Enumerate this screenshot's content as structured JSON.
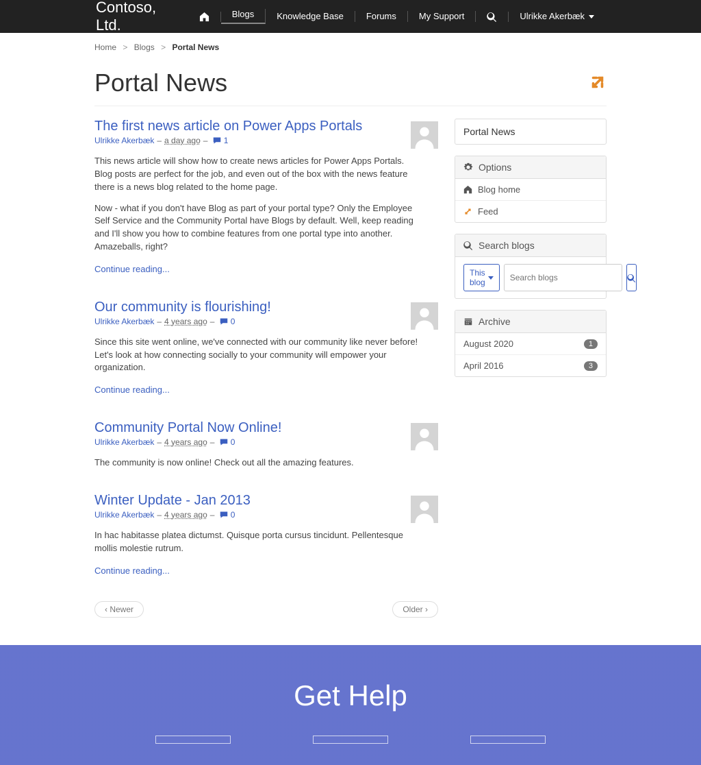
{
  "brand": "Contoso, Ltd.",
  "nav": {
    "items": [
      "Blogs",
      "Knowledge Base",
      "Forums",
      "My Support"
    ],
    "user": "Ulrikke Akerbæk"
  },
  "breadcrumb": {
    "home": "Home",
    "blogs": "Blogs",
    "current": "Portal News"
  },
  "page_title": "Portal News",
  "posts": [
    {
      "title": "The first news article on Power Apps Portals",
      "author": "Ulrikke Akerbæk",
      "time": "a day ago",
      "comments": "1",
      "body1": "This news article will show how to create news articles for Power Apps Portals.",
      "body2": "Blog posts are perfect for the job, and even out of the box with the news feature there is a news blog related to the home page.",
      "body3": "Now - what if you don't have Blog as part of your portal type? Only the Employee Self Service and the Community Portal have Blogs by default. Well, keep reading and I'll show you how to combine features from one portal type into another. Amazeballs, right?",
      "continue": "Continue reading..."
    },
    {
      "title": "Our community is flourishing!",
      "author": "Ulrikke Akerbæk",
      "time": "4 years ago",
      "comments": "0",
      "body1": "Since this site went online, we've connected with our community like never before! Let's look at how connecting socially to your community will empower your organization.",
      "continue": "Continue reading..."
    },
    {
      "title": "Community Portal Now Online!",
      "author": "Ulrikke Akerbæk",
      "time": "4 years ago",
      "comments": "0",
      "body1": "The community is now online! Check out all the amazing features."
    },
    {
      "title": "Winter Update - Jan 2013",
      "author": "Ulrikke Akerbæk",
      "time": "4 years ago",
      "comments": "0",
      "body1": "In hac habitasse platea dictumst. Quisque porta cursus tincidunt. Pellentesque mollis molestie rutrum.",
      "continue": "Continue reading..."
    }
  ],
  "pager": {
    "newer": "‹ Newer",
    "older": "Older ›"
  },
  "sidebar": {
    "title": "Portal News",
    "options_header": "Options",
    "blog_home": "Blog home",
    "feed": "Feed",
    "search_header": "Search blogs",
    "scope": "This blog",
    "search_placeholder": "Search blogs",
    "archive_header": "Archive",
    "archive": [
      {
        "label": "August 2020",
        "count": "1"
      },
      {
        "label": "April 2016",
        "count": "3"
      }
    ]
  },
  "get_help": "Get Help"
}
